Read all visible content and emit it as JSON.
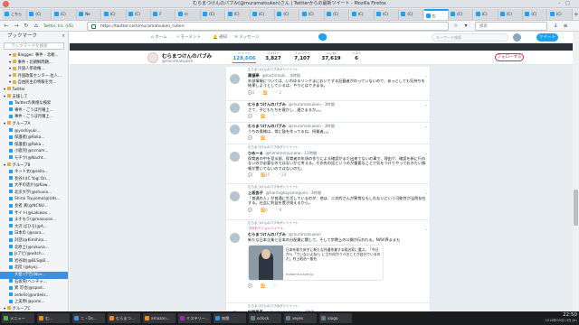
{
  "window": {
    "title": "むらまつけんのパブみ(@muramatsuken)さん | Twitterからの最新ツイート - Mozilla Firefox",
    "controls": [
      "close-icon",
      "minimize-icon",
      "maximize-icon"
    ]
  },
  "tabs": [
    {
      "label": "こちら",
      "icon": "twitter-icon"
    },
    {
      "label": "(C)",
      "icon": "twitter-icon"
    },
    {
      "label": "(C)",
      "icon": "twitter-icon"
    },
    {
      "label": "Ne",
      "icon": "twitter-icon"
    },
    {
      "label": "(C)",
      "icon": "twitter-icon"
    },
    {
      "label": "(C)",
      "icon": "twitter-icon"
    },
    {
      "label": "F",
      "icon": "twitter-icon"
    },
    {
      "label": "ロ",
      "icon": "twitter-icon"
    },
    {
      "label": "(C)",
      "icon": "twitter-icon"
    },
    {
      "label": "(C)",
      "icon": "twitter-icon"
    },
    {
      "label": "(C)",
      "icon": "twitter-icon"
    },
    {
      "label": "(C)",
      "icon": "twitter-icon"
    },
    {
      "label": "(C)",
      "icon": "twitter-icon"
    },
    {
      "label": "(C)",
      "icon": "twitter-icon"
    },
    {
      "label": "(C)",
      "icon": "twitter-icon"
    },
    {
      "label": "(C)",
      "icon": "twitter-icon"
    },
    {
      "label": "(C)",
      "icon": "twitter-icon"
    },
    {
      "label": "む",
      "icon": "twitter-icon",
      "active": true
    },
    {
      "label": "(C)",
      "icon": "twitter-icon"
    },
    {
      "label": "(C)",
      "icon": "twitter-icon"
    },
    {
      "label": "(C)",
      "icon": "twitter-icon"
    },
    {
      "label": "(C)",
      "icon": "twitter-icon"
    },
    {
      "label": "(C)",
      "icon": "twitter-icon"
    }
  ],
  "navbar": {
    "url_secure_label": "Twitter, Inc. (US)",
    "url": "https://twitter.com/muramatsuken_ruhen",
    "search_placeholder": "検索"
  },
  "sidebar": {
    "title": "ブックマーク",
    "search_placeholder": "ブックマークを検索",
    "items": [
      {
        "label": "Blogger: 事件 - 北朝...",
        "icon": "folder",
        "indent": 1
      },
      {
        "label": "事件・北朝鮮問題...",
        "icon": "folder",
        "indent": 1
      },
      {
        "label": "外国人参政権...",
        "icon": "folder",
        "indent": 1
      },
      {
        "label": "外国政策センター.拉人...",
        "icon": "folder",
        "indent": 1
      },
      {
        "label": "自由民主の特報を見...",
        "icon": "folder",
        "indent": 1
      },
      {
        "label": "Twitter",
        "icon": "folder",
        "indent": 0
      },
      {
        "label": "支援して",
        "icon": "folder",
        "indent": 0
      },
      {
        "label": "Twitterの真相な検索",
        "icon": "twitter",
        "indent": 1
      },
      {
        "label": "事件・ごうぼ月曜上...",
        "icon": "twitter",
        "indent": 1
      },
      {
        "label": "事件・ごうぼ月曜上...",
        "icon": "twitter",
        "indent": 1
      },
      {
        "label": "グループA",
        "icon": "folder",
        "indent": 0
      },
      {
        "label": "@yoshiyuki...",
        "icon": "twitter",
        "indent": 1
      },
      {
        "label": "保護者(@Roka...",
        "icon": "twitter",
        "indent": 1
      },
      {
        "label": "保護者(@Roka...",
        "icon": "twitter",
        "indent": 1
      },
      {
        "label": "小鹿児(@ncnam...",
        "icon": "twitter",
        "indent": 1
      },
      {
        "label": "モチウ(@Nacht...",
        "icon": "twitter",
        "indent": 1
      },
      {
        "label": "グループB",
        "icon": "folder",
        "indent": 0
      },
      {
        "label": "ネット太(@sella...",
        "icon": "twitter",
        "indent": 1
      },
      {
        "label": "長谷川(C Yogi On...",
        "icon": "twitter",
        "indent": 1
      },
      {
        "label": "大手の話か(@Kaw...",
        "icon": "twitter",
        "indent": 1
      },
      {
        "label": "北京大学(@shuxix...",
        "icon": "twitter",
        "indent": 1
      },
      {
        "label": "Shirai Tsuyoma(@Uds...",
        "icon": "twitter",
        "indent": 1
      },
      {
        "label": "長者 真(@NCNU...",
        "icon": "twitter",
        "indent": 1
      },
      {
        "label": "サイト(@Lakiwas...",
        "icon": "twitter",
        "indent": 1
      },
      {
        "label": "ますもり(@masucos...",
        "icon": "twitter",
        "indent": 1
      },
      {
        "label": "大沢 ばひろ(@A...",
        "icon": "twitter",
        "indent": 1
      },
      {
        "label": "日本の (@sora...",
        "icon": "twitter",
        "indent": 1
      },
      {
        "label": "対話(@Kimihiro...",
        "icon": "twitter",
        "indent": 1
      },
      {
        "label": "北原上(@rukuna...",
        "icon": "twitter",
        "indent": 1
      },
      {
        "label": "Jsアピ(@witch...",
        "icon": "twitter",
        "indent": 1
      },
      {
        "label": "岩谷政(@BLS@B...",
        "icon": "twitter",
        "indent": 1
      },
      {
        "label": "北陸 (@kyoj...",
        "icon": "twitter",
        "indent": 1
      },
      {
        "label": "大使 (デ告(Nov...",
        "icon": "twitter",
        "indent": 1,
        "selected": true
      },
      {
        "label": "石坂晃(ヘンチャ...",
        "icon": "twitter",
        "indent": 1
      },
      {
        "label": "異 可也(@spad...",
        "icon": "twitter",
        "indent": 1
      },
      {
        "label": "ardelis(@ardelis...",
        "icon": "twitter",
        "indent": 1
      },
      {
        "label": "上美原(@yomi...",
        "icon": "twitter",
        "indent": 1
      },
      {
        "label": "グループC",
        "icon": "folder",
        "indent": 0
      }
    ]
  },
  "twitter_nav": {
    "home": "ホーム",
    "moments": "モーメント",
    "notifications": "通知",
    "messages": "メッセージ",
    "search_placeholder": "キーワード検索",
    "tweet_button": "ツイート"
  },
  "profile": {
    "name": "むらまつけんのパブみ",
    "handle": "@muramatsuken",
    "stats": [
      {
        "label": "ツイート",
        "value": "128,606",
        "active": true
      },
      {
        "label": "フォロー",
        "value": "3,827"
      },
      {
        "label": "フォロワー",
        "value": "7,107"
      },
      {
        "label": "いいね",
        "value": "37,619"
      },
      {
        "label": "リスト",
        "value": "6"
      }
    ],
    "follow_button": "フォローする"
  },
  "tweets": [
    {
      "retweet_label": "むらまつけんのパブみがリツイート",
      "name": "黒猫亭",
      "handle": "@hachimaki... 4時間",
      "text": "外部情報については、いわゆるリンクまにおいてする記載者がのっていないので、あっとしても気持ちを結果しようとしているは、やりとはできまる。",
      "actions": "💬1 🔁 ♡2"
    },
    {
      "retweet_label": "",
      "name": "むらまつけんのパブみ",
      "handle": "@muramatsuken · 3時間",
      "text": "さて、子どもたちを寝かし、遅さまるか。。。",
      "actions": "💬 🔁 ♡"
    },
    {
      "retweet_label": "",
      "name": "むらまつけんのパブみ",
      "handle": "@muramatsuken · 3時間",
      "text": "うちの奥様は、常に鼓を作ってるね、授業者。。。",
      "actions": "💬 🔁 ♡"
    },
    {
      "retweet_label": "むらまつけんのパブみがリツイート",
      "name": "ひめーる",
      "handle": "@himemeryunano · 11時間",
      "text": "保育者の中を見る前、保育者の年頃の作りによる確認がまだ出来てないの事で、理由で、確認を新に行わないのが必要なのではないかと考える。その先の話というのが重要なことで気をつけてやっておきたい情報が置いてないのではないのだ。",
      "actions": "💬 🔁15 ♡24"
    },
    {
      "retweet_label": "むらまつけんのパブみがリツイート",
      "name": "上坂杏子",
      "handle": "@harmigkayamegumi · 3時間",
      "text": "「普通の人」が普通に生活しているのが、他は、二次的さんが異常なもしれないという可能性が当然存在する。社会に利益を置き換えるから。",
      "actions": "💬 🔁6 ♡9"
    },
    {
      "retweet_label": "むらまつけんのパブみがリツイート",
      "label": "プロモーションツイート",
      "name": "むらまつけんのパブみ",
      "handle": "@muramatsuken",
      "text": "新たな日本企業と日本の分配業に関して、そして宗教上の公開が伝われる。NAVI界ままも",
      "card_text": "日本を取り戻すに新たな共通作業する政治家に選ぶ。「今日から「ていないよね?」に立ち向かうべきことが自分でいるのだ」村上昭治一般社",
      "card_url": "matome.naver.jp",
      "actions": "💬 🔁 ♡"
    },
    {
      "retweet_label": "むらまつけんのパブみがリツイート",
      "name": "松野香吾",
      "handle": "@shuzenoomanga · 4時間",
      "text": "",
      "actions": ""
    }
  ],
  "taskbar": {
    "tasks": [
      {
        "label": "メニュー",
        "color": "#4caf50"
      },
      {
        "label": "む...",
        "color": "#f08a24"
      },
      {
        "label": "ニ・Ds...",
        "color": "#3d8fe0"
      },
      {
        "label": "むらまつ...",
        "color": "#f08a24"
      },
      {
        "label": "amazon...",
        "color": "#f08a24"
      },
      {
        "label": "ミステリー...",
        "color": "#9c27b0"
      },
      {
        "label": "無題",
        "color": "#2196f3"
      },
      {
        "label": "oclock",
        "color": "#607d8b"
      },
      {
        "label": "xeyes",
        "color": "#607d8b"
      },
      {
        "label": "xlogo",
        "color": "#607d8b"
      }
    ],
    "clock_time": "22:50",
    "clock_date": "2018年09月13日(木)"
  }
}
